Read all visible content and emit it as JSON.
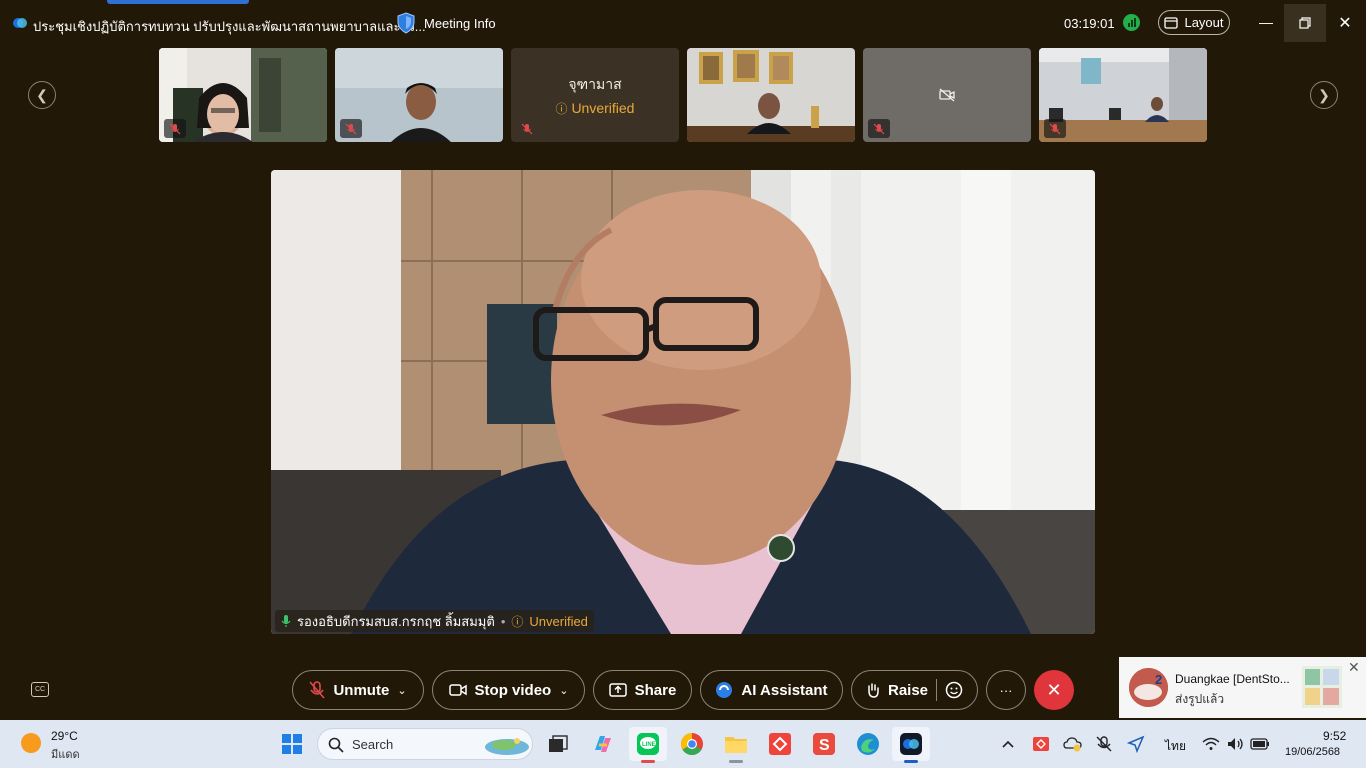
{
  "titlebar": {
    "meeting_title": "ประชุมเชิงปฏิบัติการทบทวน ปรับปรุงและพัฒนาสถานพยาบาลและรว...",
    "meeting_info": "Meeting Info",
    "timer": "03:19:01",
    "layout_label": "Layout"
  },
  "thumbnails": [
    {
      "type": "video"
    },
    {
      "type": "video"
    },
    {
      "type": "name",
      "name": "จุฑามาส",
      "status": "Unverified"
    },
    {
      "type": "video"
    },
    {
      "type": "video-off"
    },
    {
      "type": "video"
    }
  ],
  "speaker": {
    "name": "รองอธิบดีกรมสบส.กรกฤช ลิ้มสมมุติ",
    "status": "Unverified"
  },
  "controls": {
    "unmute": "Unmute",
    "stop_video": "Stop video",
    "share": "Share",
    "ai_assistant": "AI Assistant",
    "raise": "Raise",
    "more": "···"
  },
  "toast": {
    "name": "Duangkae [DentSto...",
    "message": "ส่งรูปแล้ว"
  },
  "taskbar": {
    "temperature": "29°C",
    "condition": "มีแดด",
    "search_label": "Search",
    "language": "ไทย",
    "time": "9:52",
    "date": "19/06/2568"
  },
  "colors": {
    "background": "#211808",
    "unverified": "#e9a93a",
    "end_call": "#e0353b",
    "signal": "#23b04a"
  }
}
